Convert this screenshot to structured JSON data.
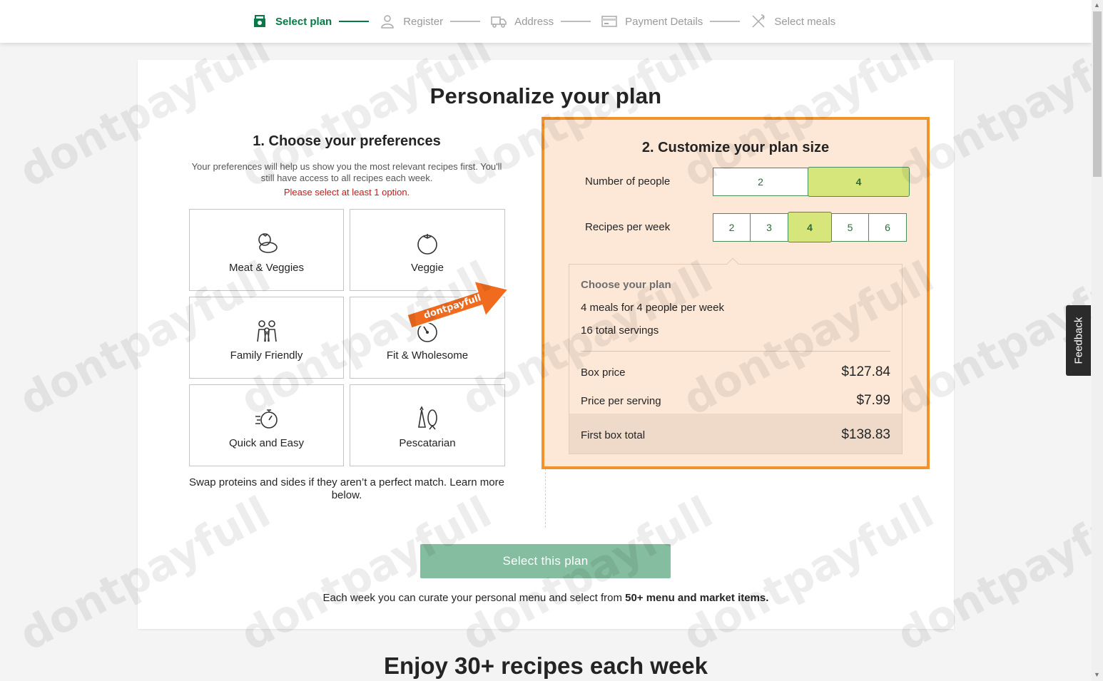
{
  "stepper": {
    "steps": [
      {
        "label": "Select plan",
        "icon": "box-icon",
        "active": true
      },
      {
        "label": "Register",
        "icon": "user-icon",
        "active": false
      },
      {
        "label": "Address",
        "icon": "truck-icon",
        "active": false
      },
      {
        "label": "Payment Details",
        "icon": "card-icon",
        "active": false
      },
      {
        "label": "Select meals",
        "icon": "utensils-icon",
        "active": false
      }
    ]
  },
  "page": {
    "title": "Personalize your plan"
  },
  "preferences": {
    "heading": "1. Choose your preferences",
    "description": "Your preferences will help us show you the most relevant recipes first. You'll still have access to all recipes each week.",
    "warning": "Please select at least 1 option.",
    "options": [
      {
        "label": "Meat & Veggies",
        "icon": "meat-veggies-icon"
      },
      {
        "label": "Veggie",
        "icon": "tomato-icon"
      },
      {
        "label": "Family Friendly",
        "icon": "family-icon"
      },
      {
        "label": "Fit & Wholesome",
        "icon": "scale-icon"
      },
      {
        "label": "Quick and Easy",
        "icon": "stopwatch-icon"
      },
      {
        "label": "Pescatarian",
        "icon": "fish-carrot-icon"
      }
    ],
    "footnote": "Swap proteins and sides if they aren’t a perfect match. Learn more below."
  },
  "plan": {
    "heading": "2. Customize your plan size",
    "people_label": "Number of people",
    "people_options": [
      "2",
      "4"
    ],
    "people_selected": "4",
    "recipes_label": "Recipes per week",
    "recipe_options": [
      "2",
      "3",
      "4",
      "5",
      "6"
    ],
    "recipes_selected": "4",
    "summary": {
      "heading": "Choose your plan",
      "line1": "4 meals for 4 people per week",
      "line2": "16 total servings",
      "box_price_label": "Box price",
      "box_price": "$127.84",
      "per_serving_label": "Price per serving",
      "per_serving": "$7.99",
      "first_box_label": "First box total",
      "first_box": "$138.83"
    }
  },
  "cta": {
    "button": "Select this plan",
    "note_prefix": "Each week you can curate your personal menu and select from ",
    "note_bold": "50+ menu and market items."
  },
  "section2": {
    "title": "Enjoy 30+ recipes each week"
  },
  "feedback": {
    "label": "Feedback"
  },
  "watermark": {
    "text": "dontpayfull"
  },
  "colors": {
    "accent_green": "#067a46",
    "highlight_orange": "#f0932b",
    "selected_option": "#d6e67a",
    "cta": "#84bd9f",
    "warning": "#c11b1b"
  }
}
